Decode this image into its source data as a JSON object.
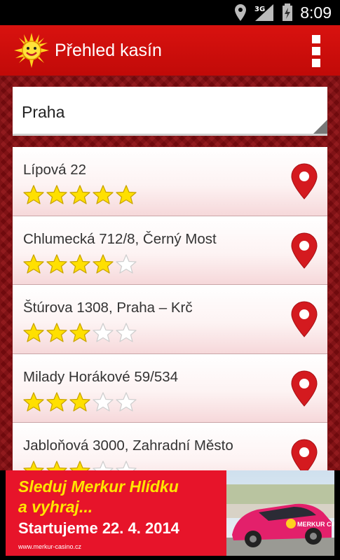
{
  "status_bar": {
    "time": "8:09",
    "network": "3G",
    "icons": [
      "location-icon",
      "signal-icon",
      "battery-icon"
    ]
  },
  "action_bar": {
    "title": "Přehled kasín",
    "logo_icon": "merkur-sun-logo",
    "menu_icon": "overflow-menu-icon"
  },
  "city_select": {
    "value": "Praha"
  },
  "casinos": [
    {
      "address": "Lípová 22",
      "rating": 5,
      "max_rating": 5
    },
    {
      "address": "Chlumecká 712/8, Černý Most",
      "rating": 4,
      "max_rating": 5
    },
    {
      "address": "Štúrova 1308, Praha – Krč",
      "rating": 3,
      "max_rating": 5
    },
    {
      "address": "Milady Horákové 59/534",
      "rating": 3,
      "max_rating": 5
    },
    {
      "address": "Jabloňová 3000, Zahradní Město",
      "rating": 3,
      "max_rating": 5
    }
  ],
  "banner": {
    "line1": "Sleduj Merkur Hlídku",
    "line2": "a vyhraj...",
    "line3": "Startujeme 22. 4. 2014",
    "url": "www.merkur-casino.cz",
    "car_logo": "MERKUR CASINO"
  },
  "colors": {
    "action_bar": "#d9120f",
    "content_bg": "#8a0c10",
    "banner_bg": "#e7142a",
    "banner_headline": "#ffe600",
    "star_filled": "#ffe000",
    "pin": "#d41a1f"
  }
}
